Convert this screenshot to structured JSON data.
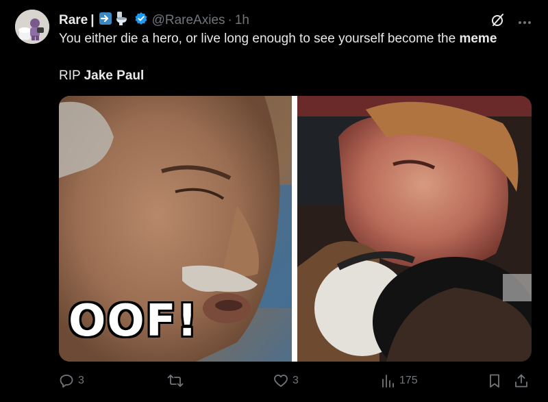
{
  "author": {
    "name": "Rare",
    "separator": "|",
    "handle": "@RareAxies",
    "dot": "·",
    "time": "1h",
    "verified": true
  },
  "tweet": {
    "line1_prefix": "You either die a hero, or live long enough to see yourself become the ",
    "line1_bold": "meme",
    "line2_prefix": "RIP ",
    "line2_bold": "Jake Paul"
  },
  "media": {
    "left_caption": "OOF!"
  },
  "actions": {
    "reply_count": "3",
    "retweet_count": "",
    "like_count": "3",
    "views_count": "175"
  },
  "colors": {
    "background": "#000000",
    "text": "#e7e9ea",
    "muted": "#71767b",
    "verified": "#1d9bf0"
  },
  "icons": [
    "grok-icon",
    "more-icon",
    "reply-icon",
    "retweet-icon",
    "like-icon",
    "views-icon",
    "bookmark-icon",
    "share-icon",
    "verified-badge-icon",
    "arrow-right-emoji-icon",
    "toilet-emoji-icon"
  ]
}
